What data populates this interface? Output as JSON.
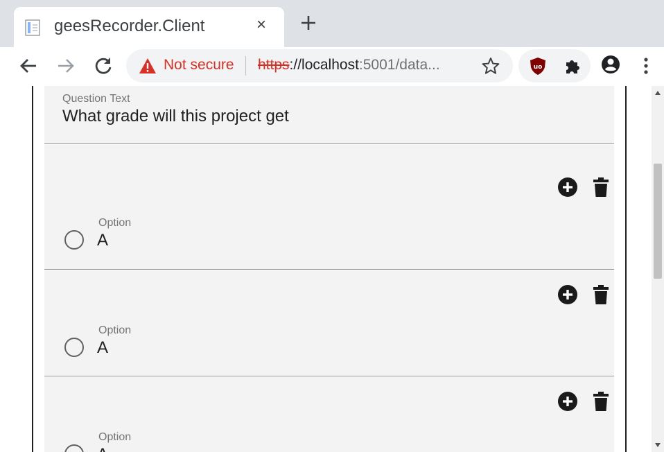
{
  "browser": {
    "tab": {
      "title": "geesRecorder.Client",
      "close_glyph": "×",
      "favicon": "page-icon"
    },
    "new_tab_icon": "plus-icon",
    "toolbar": {
      "back_icon": "arrow-left-icon",
      "forward_icon": "arrow-right-icon",
      "reload_icon": "reload-icon",
      "security_label": "Not secure",
      "url_scheme": "https",
      "url_host": "://localhost",
      "url_rest": ":5001/data...",
      "bookmark_icon": "star-icon",
      "extensions": [
        "ublock-origin-icon",
        "puzzle-icon",
        "account-icon"
      ],
      "menu_icon": "kebab-menu-icon"
    }
  },
  "form": {
    "question": {
      "label": "Question Text",
      "value": "What grade will this project get"
    },
    "options": [
      {
        "label": "Option",
        "value": "A"
      },
      {
        "label": "Option",
        "value": "A"
      },
      {
        "label": "Option",
        "value": "A"
      }
    ]
  },
  "colors": {
    "warning": "#d93025",
    "card_bg": "#f3f3f3",
    "icon": "#1a1a1a"
  }
}
